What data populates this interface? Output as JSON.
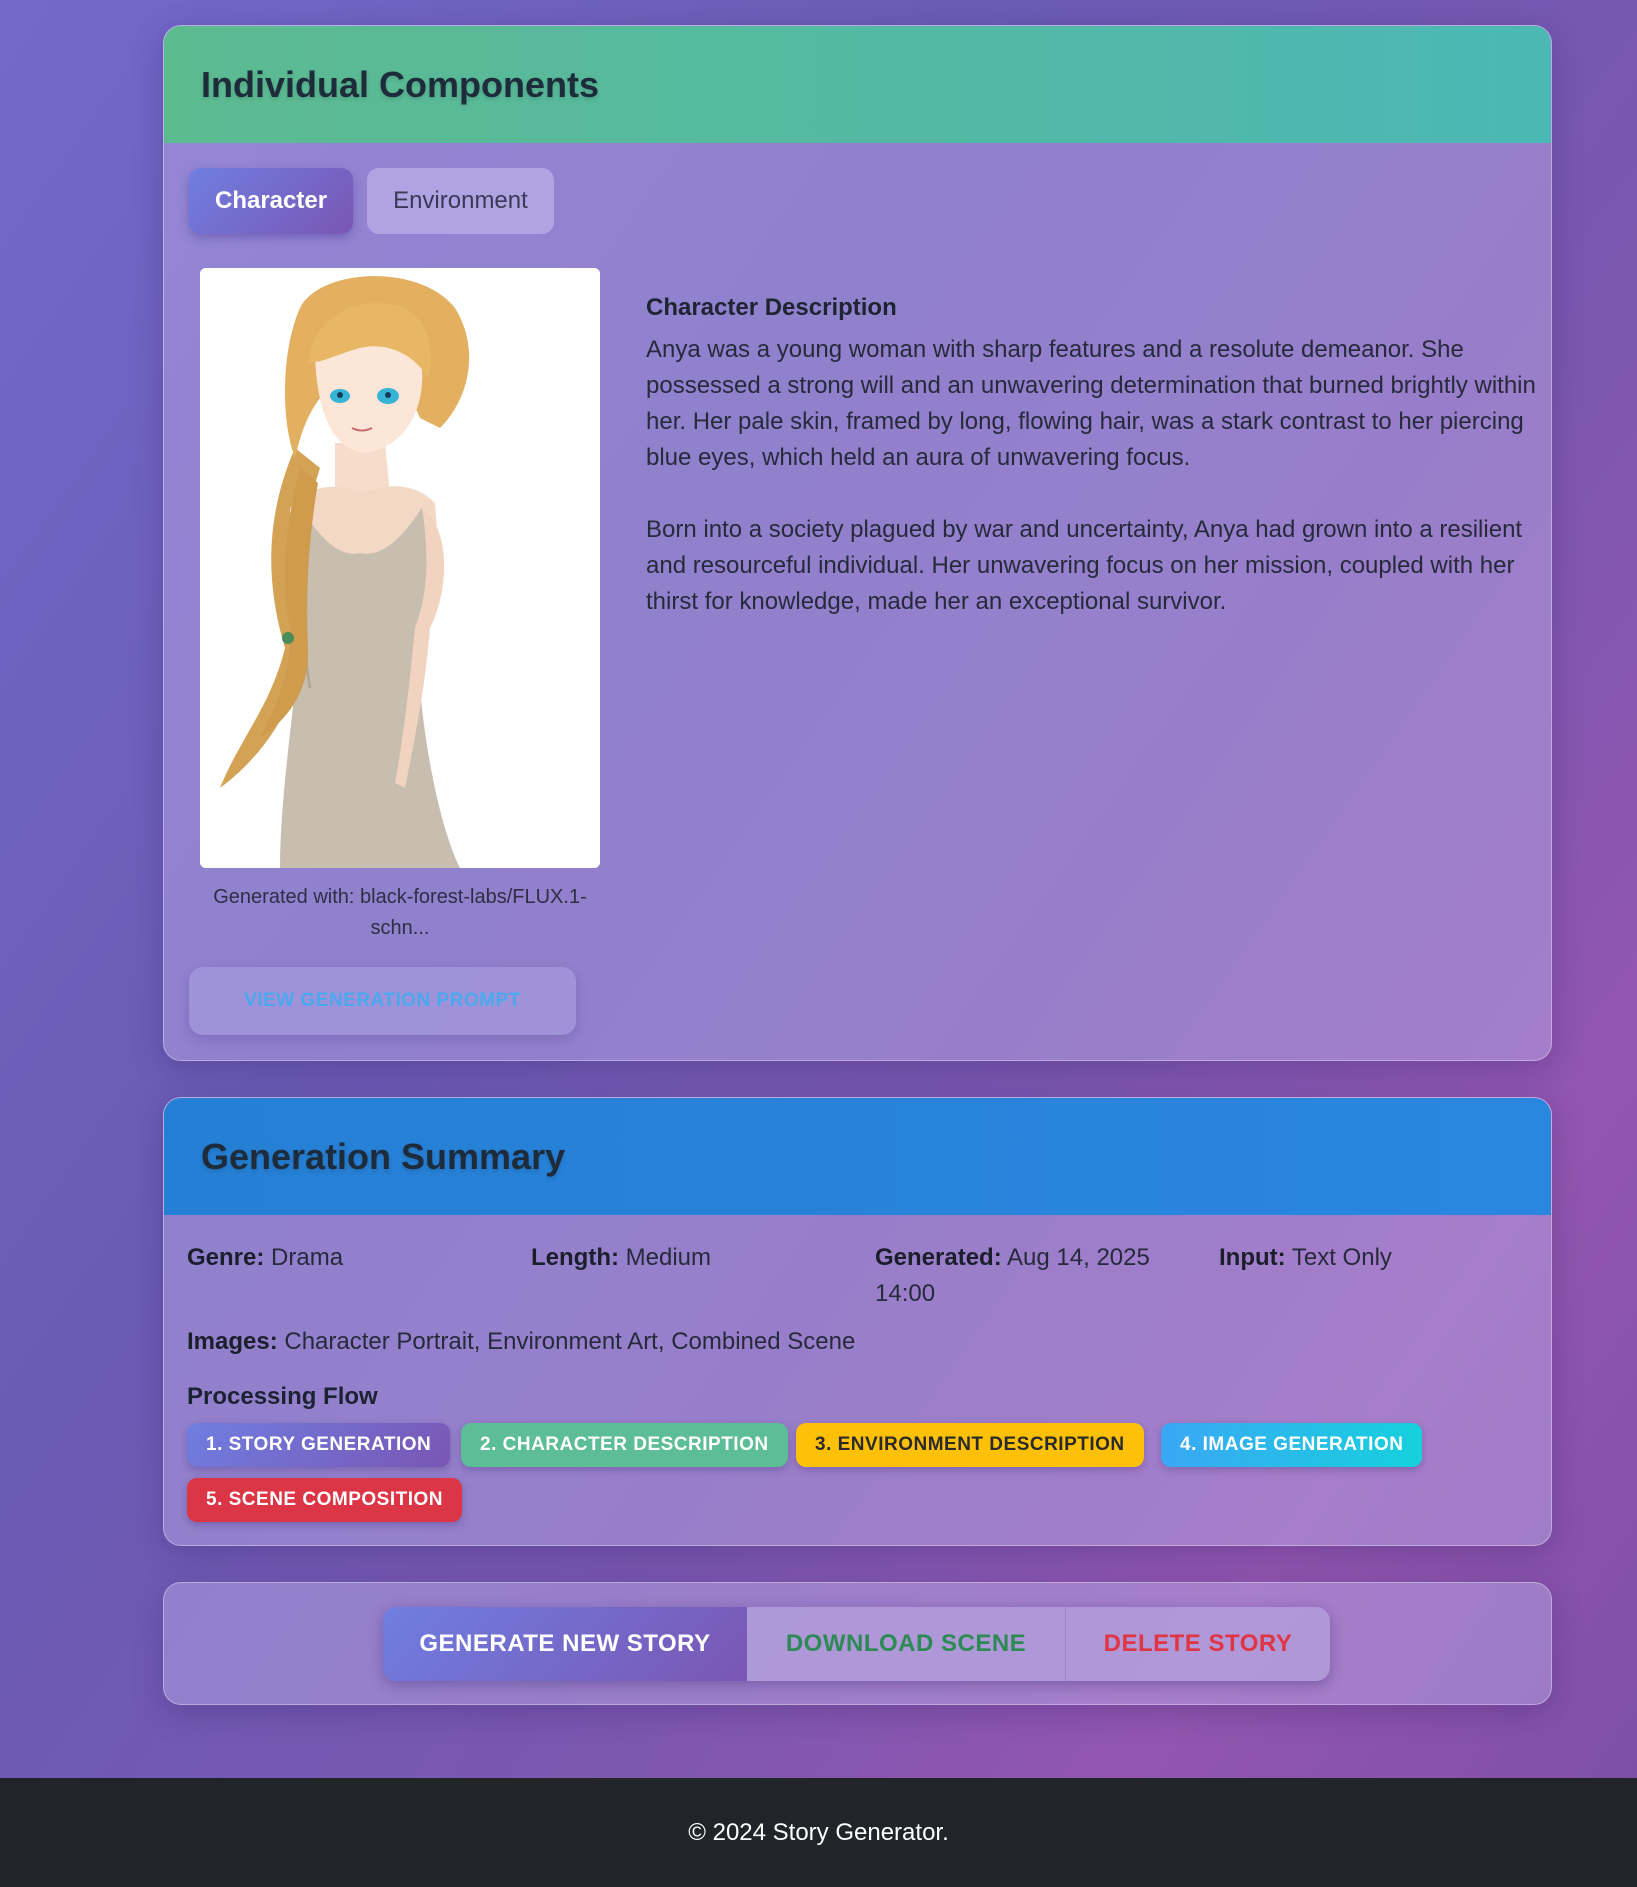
{
  "components": {
    "title": "Individual Components",
    "tabs": [
      {
        "label": "Character",
        "active": true
      },
      {
        "label": "Environment",
        "active": false
      }
    ],
    "caption": "Generated with: black-forest-labs/FLUX.1-schn...",
    "prompt_button": "View Generation Prompt",
    "description": {
      "heading": "Character Description",
      "paragraphs": [
        "Anya was a young woman with sharp features and a resolute demeanor. She possessed a strong will and an unwavering determination that burned brightly within her. Her pale skin, framed by long, flowing hair, was a stark contrast to her piercing blue eyes, which held an aura of unwavering focus.",
        "Born into a society plagued by war and uncertainty, Anya had grown into a resilient and resourceful individual. Her unwavering focus on her mission, coupled with her thirst for knowledge, made her an exceptional survivor."
      ]
    }
  },
  "summary": {
    "title": "Generation Summary",
    "genre_label": "Genre:",
    "genre": "Drama",
    "length_label": "Length:",
    "length": "Medium",
    "generated_label": "Generated:",
    "generated": "Aug 14, 2025 14:00",
    "input_label": "Input:",
    "input": "Text Only",
    "images_label": "Images:",
    "images": "Character Portrait, Environment Art, Combined Scene",
    "flow_title": "Processing Flow",
    "flow": [
      {
        "label": "1. Story Generation",
        "color": "#7265c4"
      },
      {
        "label": "2. Character Description",
        "color": "#5cbd96"
      },
      {
        "label": "3. Environment Description",
        "color": "#ffc107"
      },
      {
        "label": "4. Image Generation",
        "color": "#33b6f0"
      },
      {
        "label": "5. Scene Composition",
        "color": "#dc3545"
      }
    ]
  },
  "actions": {
    "generate": "Generate New Story",
    "download": "Download Scene",
    "delete": "Delete Story"
  },
  "footer": "© 2024 Story Generator."
}
